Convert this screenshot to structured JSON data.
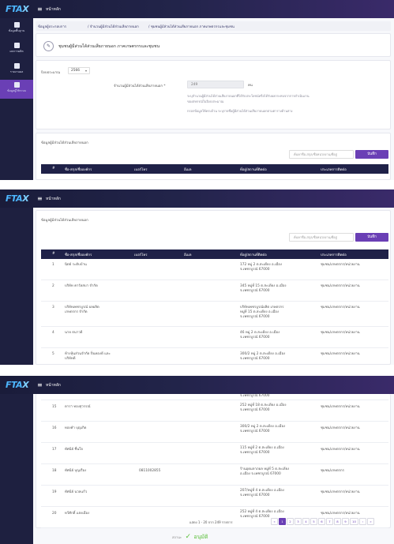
{
  "app": {
    "logo": "FTA",
    "logo_x": "X",
    "home_label": "หน้าหลัก",
    "menu_icon": "hamburger-icon"
  },
  "sidebar": {
    "items": [
      {
        "label": "ข้อมูลพื้นฐาน",
        "icon": "grid-icon"
      },
      {
        "label": "ผลการผลิต",
        "icon": "chart-icon"
      },
      {
        "label": "รายงานผล",
        "icon": "document-icon"
      },
      {
        "label": "ข้อมูลผู้ใช้ระบบ",
        "icon": "user-icon"
      }
    ]
  },
  "breadcrumb": [
    "ข้อมูลผู้ประกอบการ",
    "/ จำนวนผู้มีส่วนได้ส่วนเสียภายนอก",
    "/ ชุมชนผู้มีส่วนได้ส่วนเสียภายนอก ภาคเกษตรกรและชุมชน"
  ],
  "page": {
    "title": "ชุมชนผู้มีส่วนได้ส่วนเสียภายนอก ภาคเกษตรกรและชุมชน",
    "year_label": "ปีงบประมาณ",
    "year_value": "2566",
    "count_label": "จำนวนผู้มีส่วนได้ส่วนเสียภายนอก *",
    "count_value": "249",
    "count_unit": "คน",
    "note_1": "ระบุจำนวนผู้มีส่วนได้ส่วนเสียภายนอกที่ได้รับประโยชน์หรือได้รับผลกระทบจากการดำเนินงาน",
    "note_2": "ของสหกรณ์ในปีงบประมาณ",
    "note_3": "กรอกข้อมูลให้ครบถ้วน ระบุรายชื่อผู้มีส่วนได้ส่วนเสียภายนอกตามตารางด้านล่าง"
  },
  "list_section": {
    "title": "ข้อมูลผู้มีส่วนได้ส่วนเสียภายนอก",
    "search_placeholder": "ค้นหาชื่อ-สกุล/ชื่อหน่วยงาน/ที่อยู่",
    "save_label": "บันทึก"
  },
  "table": {
    "columns": [
      "#",
      "ชื่อ-สกุล/ชื่อองค์กร",
      "เบอร์โทร",
      "อีเมล",
      "ที่อยู่/สถานที่ติดต่อ",
      "ประเภทการติดต่อ"
    ],
    "rows_top": [
      {
        "no": "1",
        "name": "นิตย์ ระดับบ้าน",
        "phone": "",
        "email": "",
        "addr1": "172 หมู่ 2 ต.สะเดียง อ.เมือง",
        "addr2": "จ.เพชรบูรณ์ 67000",
        "type": "ชุมชน/เกษตรกร/หน่วยงาน"
      },
      {
        "no": "2",
        "name": "บริษัท คาร์ลสบา จำกัด",
        "phone": "",
        "email": "",
        "addr1": "345 หมู่ที่ 15 ต.สะเดียง อ.เมือง",
        "addr2": "จ.เพชรบูรณ์ 67000",
        "type": "ชุมชน/เกษตรกร/หน่วยงาน"
      },
      {
        "no": "3",
        "name": "บริษัทเพชรบูรณ์ ผลผลิต",
        "name2": "เกษตรกร จำกัด",
        "phone": "",
        "email": "",
        "addr1": "บริษัทเพชรบูรณ์ผลิต เกษตรกร",
        "addr2": "หมู่ที่ 15 ต.สะเดียง อ.เมือง",
        "addr3": "จ.เพชรบูรณ์ 67000",
        "type": "ชุมชน/เกษตรกร/หน่วยงาน"
      },
      {
        "no": "4",
        "name": "นาย ธนาวดี",
        "phone": "",
        "email": "",
        "addr1": "46 หมู่ 2 ต.สะเดียง อ.เมือง",
        "addr2": "จ.เพชรบูรณ์ 67000",
        "type": "ชุมชน/เกษตรกร/หน่วยงาน"
      },
      {
        "no": "5",
        "name": "ห้างหุ้นส่วนจำกัด ปิ่นทองดี และ",
        "name2": "บริษัทดี",
        "phone": "",
        "email": "",
        "addr1": "300/2 หมู่ 2 ต.สะเดียง อ.เมือง",
        "addr2": "จ.เพชรบูรณ์ 67000",
        "type": "ชุมชน/เกษตรกร/หน่วยงาน"
      }
    ],
    "rows_bottom": [
      {
        "no": "15",
        "name": "ดารา ทองสุวรรณ์",
        "phone": "",
        "email": "",
        "addr1": "252 หมู่ที่ 18 ต.สะเดียง อ.เมือง",
        "addr2": "จ.เพชรบูรณ์ 67000",
        "type": "ชุมชน/เกษตรกร/หน่วยงาน"
      },
      {
        "no": "16",
        "name": "ทองคำ บุญเกิด",
        "phone": "",
        "email": "",
        "addr1": "300/2 หมู่ 2 ต.สะเดียง อ.เมือง",
        "addr2": "จ.เพชรบูรณ์ 67000",
        "type": "ชุมชน/เกษตรกร/หน่วยงาน"
      },
      {
        "no": "17",
        "name": "ทัศนีย์ ชื่นใจ",
        "phone": "",
        "email": "",
        "addr1": "115 หมู่ที่ 2 ต.สะเดียง อ.เมือง",
        "addr2": "จ.เพชรบูรณ์ 67000",
        "type": "ชุมชน/เกษตรกร/หน่วยงาน"
      },
      {
        "no": "18",
        "name": "ทัศนีย์ บุญเรือง",
        "phone": "0811002855",
        "email": "",
        "addr1": "ร้านอุดมลาภผล หมู่ที่ 5 ต.สะเดียง",
        "addr2": "อ.เมือง จ.เพชรบูรณ์ 67000",
        "type": "ชุมชน/เกษตรกร"
      },
      {
        "no": "19",
        "name": "ทัศนีย์ นวลแก้ว",
        "phone": "",
        "email": "",
        "addr1": "207/หมู่ที่ 4 ต.สะเดียง อ.เมือง",
        "addr2": "จ.เพชรบูรณ์ 67000",
        "type": "ชุมชน/เกษตรกร/หน่วยงาน"
      },
      {
        "no": "20",
        "name": "ทวีศักดิ์ แสงเมือง",
        "phone": "",
        "email": "",
        "addr1": "252 หมู่ที่ 4 ต.สะเดียง อ.เมือง",
        "addr2": "จ.เพชรบูรณ์ 67000",
        "type": "ชุมชน/เกษตรกร/หน่วยงาน"
      }
    ],
    "partial_addr": "จ.เพชรบูรณ์ 67000"
  },
  "pagination": {
    "info": "แสดง 1 - 20 จาก 249 รายการ",
    "pages": [
      "«",
      "1",
      "2",
      "3",
      "4",
      "5",
      "6",
      "7",
      "8",
      "9",
      "10",
      "›",
      "»"
    ],
    "active": "1"
  },
  "status": {
    "label": "สถานะ",
    "value": "อนุมัติ",
    "color": "#5bbf3a"
  },
  "colors": {
    "accent": "#6a3fb5",
    "header": "#1f2148",
    "topbar": "#1a1c3a"
  }
}
